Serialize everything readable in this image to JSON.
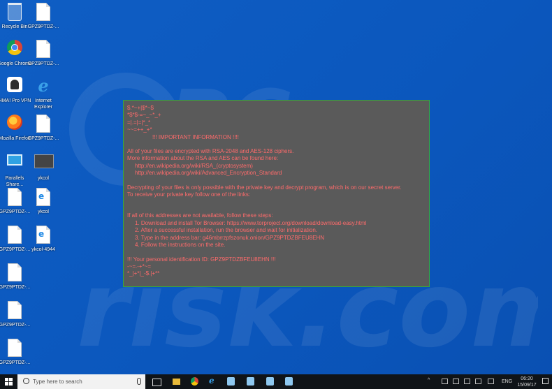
{
  "desktop": {
    "icons": [
      {
        "label": "Recycle Bin",
        "icon": "recycle-bin-icon"
      },
      {
        "label": "GPZ9PTDZ-...",
        "icon": "file-icon"
      },
      {
        "label": "Google Chrome",
        "icon": "chrome-icon"
      },
      {
        "label": "GPZ9PTDZ-...",
        "icon": "file-icon"
      },
      {
        "label": "HMA! Pro VPN",
        "icon": "hma-vpn-icon"
      },
      {
        "label": "Internet Explorer",
        "icon": "internet-explorer-icon"
      },
      {
        "label": "Mozilla Firefox",
        "icon": "firefox-icon"
      },
      {
        "label": "GPZ9PTDZ-...",
        "icon": "file-icon"
      },
      {
        "label": "Parallels Share...",
        "icon": "network-share-icon"
      },
      {
        "label": "ykcol",
        "icon": "ykcol-icon"
      },
      {
        "label": "GPZ9PTDZ-...",
        "icon": "file-icon"
      },
      {
        "label": "ykcol",
        "icon": "html-file-icon"
      },
      {
        "label": "GPZ9PTDZ-...",
        "icon": "file-icon"
      },
      {
        "label": "ykcol-4944",
        "icon": "html-file-icon"
      },
      {
        "label": "GPZ9PTDZ-...",
        "icon": "file-icon"
      },
      {
        "label": "GPZ9PTDZ-...",
        "icon": "file-icon"
      },
      {
        "label": "GPZ9PTDZ-...",
        "icon": "file-icon"
      }
    ]
  },
  "ransom_note": {
    "art_lines": [
      "$.*~+|$*~$",
      "*$*$-=~_~*_+",
      "=|.=|=|*_*",
      "~~=++_+*"
    ],
    "heading": "!!! IMPORTANT INFORMATION !!!!",
    "p1": "All of your files are encrypted with RSA-2048 and AES-128 ciphers.",
    "p2": "More information about the RSA and AES can be found here:",
    "link1": "http://en.wikipedia.org/wiki/RSA_(cryptosystem)",
    "link2": "http://en.wikipedia.org/wiki/Advanced_Encryption_Standard",
    "p3": "Decrypting of your files is only possible with the private key and decrypt program, which is on our secret server.",
    "p4": "To receive your private key follow one of the links:",
    "p5": "If all of this addresses are not available, follow these steps:",
    "steps": [
      "1. Download and install Tor Browser: https://www.torproject.org/download/download-easy.html",
      "2. After a successful installation, run the browser and wait for initialization.",
      "3. Type in the address bar: g46mbrrzpfszonuk.onion/GPZ9PTDZBFEU8EHN",
      "4. Follow the instructions on the site."
    ],
    "id_line": "!!! Your personal identification ID: GPZ9PTDZBFEU8EHN !!!",
    "end_art": [
      "-~=.-+*~=",
      "*_|+*|_-$.|+**"
    ]
  },
  "taskbar": {
    "search_placeholder": "Type here to search",
    "lang": "ENG",
    "time": "06:20",
    "date": "15/09/17"
  },
  "colors": {
    "desktop": "#0c58be",
    "note_text": "#ff6b6b",
    "note_bg": "#5a5a5a",
    "note_border": "#39a83a"
  }
}
